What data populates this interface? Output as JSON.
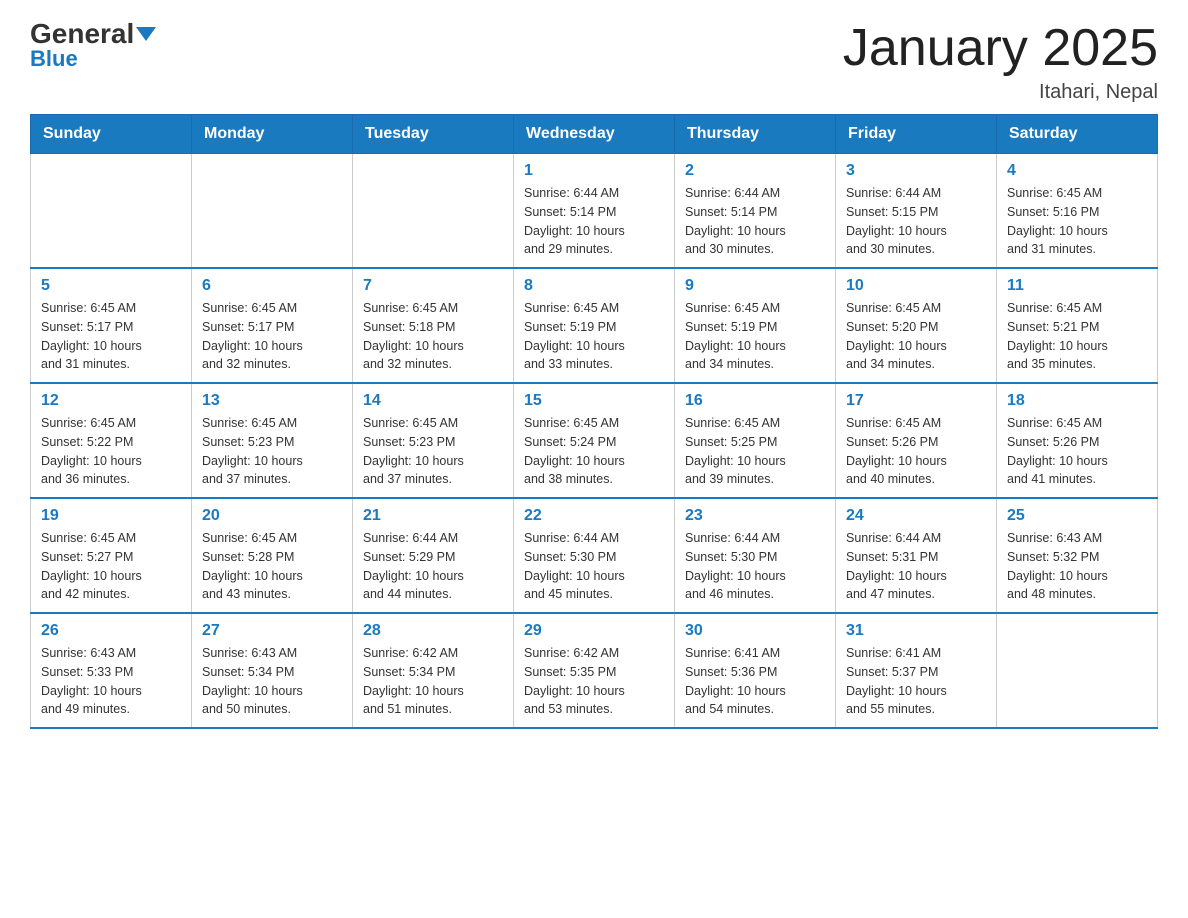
{
  "header": {
    "logo_general": "General",
    "logo_blue": "Blue",
    "title": "January 2025",
    "location": "Itahari, Nepal"
  },
  "weekdays": [
    "Sunday",
    "Monday",
    "Tuesday",
    "Wednesday",
    "Thursday",
    "Friday",
    "Saturday"
  ],
  "weeks": [
    [
      {
        "day": "",
        "info": ""
      },
      {
        "day": "",
        "info": ""
      },
      {
        "day": "",
        "info": ""
      },
      {
        "day": "1",
        "info": "Sunrise: 6:44 AM\nSunset: 5:14 PM\nDaylight: 10 hours\nand 29 minutes."
      },
      {
        "day": "2",
        "info": "Sunrise: 6:44 AM\nSunset: 5:14 PM\nDaylight: 10 hours\nand 30 minutes."
      },
      {
        "day": "3",
        "info": "Sunrise: 6:44 AM\nSunset: 5:15 PM\nDaylight: 10 hours\nand 30 minutes."
      },
      {
        "day": "4",
        "info": "Sunrise: 6:45 AM\nSunset: 5:16 PM\nDaylight: 10 hours\nand 31 minutes."
      }
    ],
    [
      {
        "day": "5",
        "info": "Sunrise: 6:45 AM\nSunset: 5:17 PM\nDaylight: 10 hours\nand 31 minutes."
      },
      {
        "day": "6",
        "info": "Sunrise: 6:45 AM\nSunset: 5:17 PM\nDaylight: 10 hours\nand 32 minutes."
      },
      {
        "day": "7",
        "info": "Sunrise: 6:45 AM\nSunset: 5:18 PM\nDaylight: 10 hours\nand 32 minutes."
      },
      {
        "day": "8",
        "info": "Sunrise: 6:45 AM\nSunset: 5:19 PM\nDaylight: 10 hours\nand 33 minutes."
      },
      {
        "day": "9",
        "info": "Sunrise: 6:45 AM\nSunset: 5:19 PM\nDaylight: 10 hours\nand 34 minutes."
      },
      {
        "day": "10",
        "info": "Sunrise: 6:45 AM\nSunset: 5:20 PM\nDaylight: 10 hours\nand 34 minutes."
      },
      {
        "day": "11",
        "info": "Sunrise: 6:45 AM\nSunset: 5:21 PM\nDaylight: 10 hours\nand 35 minutes."
      }
    ],
    [
      {
        "day": "12",
        "info": "Sunrise: 6:45 AM\nSunset: 5:22 PM\nDaylight: 10 hours\nand 36 minutes."
      },
      {
        "day": "13",
        "info": "Sunrise: 6:45 AM\nSunset: 5:23 PM\nDaylight: 10 hours\nand 37 minutes."
      },
      {
        "day": "14",
        "info": "Sunrise: 6:45 AM\nSunset: 5:23 PM\nDaylight: 10 hours\nand 37 minutes."
      },
      {
        "day": "15",
        "info": "Sunrise: 6:45 AM\nSunset: 5:24 PM\nDaylight: 10 hours\nand 38 minutes."
      },
      {
        "day": "16",
        "info": "Sunrise: 6:45 AM\nSunset: 5:25 PM\nDaylight: 10 hours\nand 39 minutes."
      },
      {
        "day": "17",
        "info": "Sunrise: 6:45 AM\nSunset: 5:26 PM\nDaylight: 10 hours\nand 40 minutes."
      },
      {
        "day": "18",
        "info": "Sunrise: 6:45 AM\nSunset: 5:26 PM\nDaylight: 10 hours\nand 41 minutes."
      }
    ],
    [
      {
        "day": "19",
        "info": "Sunrise: 6:45 AM\nSunset: 5:27 PM\nDaylight: 10 hours\nand 42 minutes."
      },
      {
        "day": "20",
        "info": "Sunrise: 6:45 AM\nSunset: 5:28 PM\nDaylight: 10 hours\nand 43 minutes."
      },
      {
        "day": "21",
        "info": "Sunrise: 6:44 AM\nSunset: 5:29 PM\nDaylight: 10 hours\nand 44 minutes."
      },
      {
        "day": "22",
        "info": "Sunrise: 6:44 AM\nSunset: 5:30 PM\nDaylight: 10 hours\nand 45 minutes."
      },
      {
        "day": "23",
        "info": "Sunrise: 6:44 AM\nSunset: 5:30 PM\nDaylight: 10 hours\nand 46 minutes."
      },
      {
        "day": "24",
        "info": "Sunrise: 6:44 AM\nSunset: 5:31 PM\nDaylight: 10 hours\nand 47 minutes."
      },
      {
        "day": "25",
        "info": "Sunrise: 6:43 AM\nSunset: 5:32 PM\nDaylight: 10 hours\nand 48 minutes."
      }
    ],
    [
      {
        "day": "26",
        "info": "Sunrise: 6:43 AM\nSunset: 5:33 PM\nDaylight: 10 hours\nand 49 minutes."
      },
      {
        "day": "27",
        "info": "Sunrise: 6:43 AM\nSunset: 5:34 PM\nDaylight: 10 hours\nand 50 minutes."
      },
      {
        "day": "28",
        "info": "Sunrise: 6:42 AM\nSunset: 5:34 PM\nDaylight: 10 hours\nand 51 minutes."
      },
      {
        "day": "29",
        "info": "Sunrise: 6:42 AM\nSunset: 5:35 PM\nDaylight: 10 hours\nand 53 minutes."
      },
      {
        "day": "30",
        "info": "Sunrise: 6:41 AM\nSunset: 5:36 PM\nDaylight: 10 hours\nand 54 minutes."
      },
      {
        "day": "31",
        "info": "Sunrise: 6:41 AM\nSunset: 5:37 PM\nDaylight: 10 hours\nand 55 minutes."
      },
      {
        "day": "",
        "info": ""
      }
    ]
  ]
}
